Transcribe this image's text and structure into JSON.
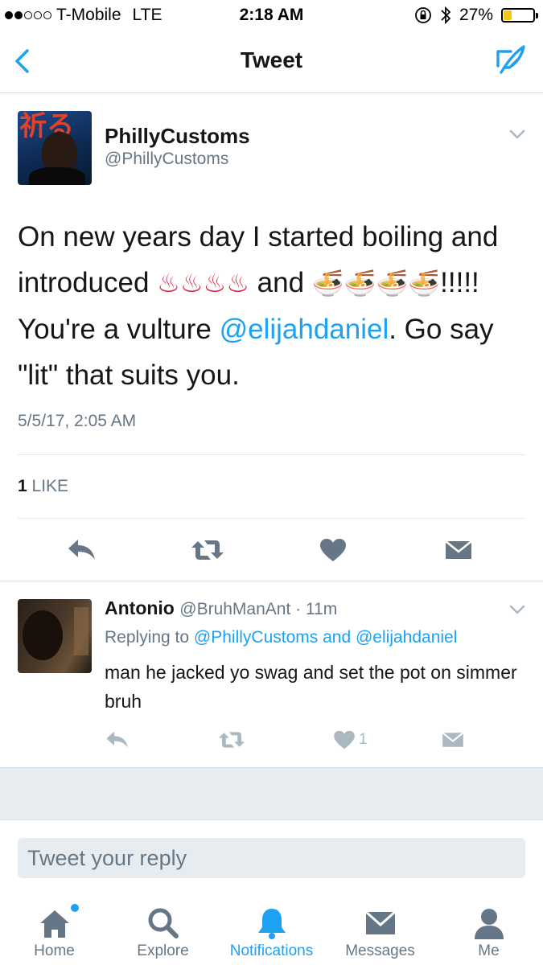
{
  "status_bar": {
    "carrier": "T-Mobile",
    "network": "LTE",
    "time": "2:18 AM",
    "battery_percent": "27%",
    "battery_level": 0.27,
    "signal_bars_filled": 2,
    "signal_bars_total": 5
  },
  "nav": {
    "title": "Tweet",
    "back_icon": "chevron-left-icon",
    "compose_icon": "compose-icon"
  },
  "main_tweet": {
    "name": "PhillyCustoms",
    "handle": "@PhillyCustoms",
    "text_part1": "On new years day I started boiling and introduced ",
    "emoji_hot": "♨♨♨♨",
    "text_part2": " and ",
    "emoji_ramen": "🍜🍜🍜🍜",
    "text_part3": "!!!!! You're a vulture ",
    "mention": "@elijahdaniel",
    "text_part4": ". Go say \"lit\" that suits you.",
    "date": "5/5/17, 2:05 AM",
    "likes_count": "1",
    "likes_label": "LIKE"
  },
  "reply_tweet": {
    "name": "Antonio",
    "handle": "@BruhManAnt",
    "separator": " · ",
    "time": "11m",
    "replying_prefix": "Replying to ",
    "replying_mention1": "@PhillyCustoms",
    "replying_and": " and ",
    "replying_mention2": "@elijahdaniel",
    "text": "man he jacked yo swag and set the pot on simmer bruh",
    "like_count": "1"
  },
  "reply_input": {
    "placeholder": "Tweet your reply"
  },
  "tabs": [
    {
      "label": "Home",
      "icon": "home-icon",
      "active": false,
      "has_dot": true
    },
    {
      "label": "Explore",
      "icon": "search-icon",
      "active": false
    },
    {
      "label": "Notifications",
      "icon": "bell-icon",
      "active": true
    },
    {
      "label": "Messages",
      "icon": "envelope-icon",
      "active": false
    },
    {
      "label": "Me",
      "icon": "person-icon",
      "active": false
    }
  ],
  "colors": {
    "accent": "#1da1f2",
    "text": "#14171a",
    "secondary": "#657786",
    "inactive_icon": "#aab8c2",
    "battery": "#f5c518"
  }
}
